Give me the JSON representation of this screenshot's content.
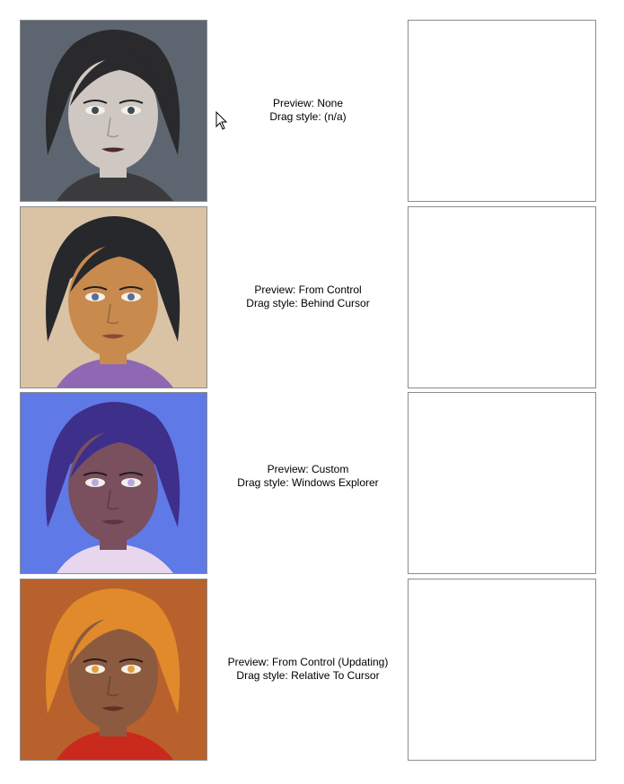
{
  "rows": [
    {
      "preview": "Preview: None",
      "drag_style": "Drag style: (n/a)",
      "portrait": {
        "bg": "#5d6670",
        "skin": "#cfc8c2",
        "hair": "#2a2a2c",
        "clothes": "#3b3b3e",
        "lip": "#4a2a2a",
        "eye": "#3d4b55"
      }
    },
    {
      "preview": "Preview: From Control",
      "drag_style": "Drag style: Behind Cursor",
      "portrait": {
        "bg": "#d9c3a4",
        "skin": "#c98a4e",
        "hair": "#26282c",
        "clothes": "#8e68b3",
        "lip": "#8a4b38",
        "eye": "#5d6f8f"
      }
    },
    {
      "preview": "Preview: Custom",
      "drag_style": "Drag style: Windows Explorer",
      "portrait": {
        "bg": "#5f79e6",
        "skin": "#7a4f5e",
        "hair": "#3d2f8a",
        "clothes": "#e8d6ef",
        "lip": "#5c3444",
        "eye": "#b9a7e0"
      }
    },
    {
      "preview": "Preview: From Control (Updating)",
      "drag_style": "Drag style: Relative To Cursor",
      "portrait": {
        "bg": "#b8612c",
        "skin": "#8c5a3e",
        "hair": "#e08a2c",
        "clothes": "#c92a1c",
        "lip": "#5d3326",
        "eye": "#e0a040"
      }
    }
  ],
  "cursor_icon": "arrow-cursor-icon"
}
